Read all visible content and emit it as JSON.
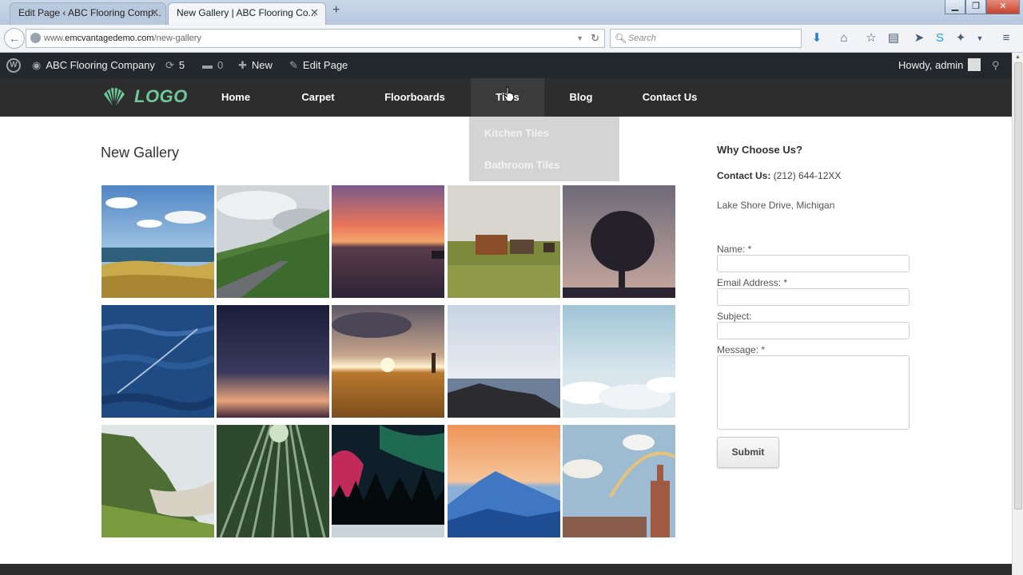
{
  "browser": {
    "tabs": [
      {
        "label": "Edit Page ‹ ABC Flooring Comp...",
        "active": false
      },
      {
        "label": "New Gallery | ABC Flooring Co...",
        "active": true
      }
    ],
    "url_prefix": "www.",
    "url_domain": "emcvantagedemo.com",
    "url_path": "/new-gallery",
    "search_placeholder": "Search"
  },
  "adminbar": {
    "site_name": "ABC Flooring Company",
    "updates_count": "5",
    "comments_count": "0",
    "new_label": "New",
    "edit_label": "Edit Page",
    "howdy": "Howdy, admin"
  },
  "header": {
    "logo_text": "LOGO",
    "menu": [
      "Home",
      "Carpet",
      "Floorboards",
      "Tiles",
      "Blog",
      "Contact Us"
    ],
    "dropdown": [
      "Kitchen Tiles",
      "Bathroom Tiles"
    ]
  },
  "main": {
    "title": "New Gallery",
    "gallery": [
      "beach-sky",
      "mountain-road",
      "sunset-sea",
      "hay-harvest",
      "silhouette-tree",
      "ocean-waves",
      "night-gradient",
      "field-sunset",
      "rocky-coast",
      "clouds-above",
      "green-cliffs",
      "bamboo-forest",
      "aurora-forest",
      "mountain-sunrise",
      "city-rainbow"
    ]
  },
  "sidebar": {
    "heading": "Why Choose Us?",
    "contact_label": "Contact Us:",
    "contact_phone": "(212) 644-12XX",
    "address": "Lake Shore Drive, Michigan",
    "form": {
      "name_label": "Name: *",
      "email_label": "Email Address: *",
      "subject_label": "Subject:",
      "message_label": "Message: *",
      "submit_label": "Submit"
    }
  },
  "colors": {
    "admin_bar": "#23282d",
    "header": "#2d2d2d",
    "logo_green": "#6cc99a",
    "dropdown_bg": "#d4d4d4"
  }
}
